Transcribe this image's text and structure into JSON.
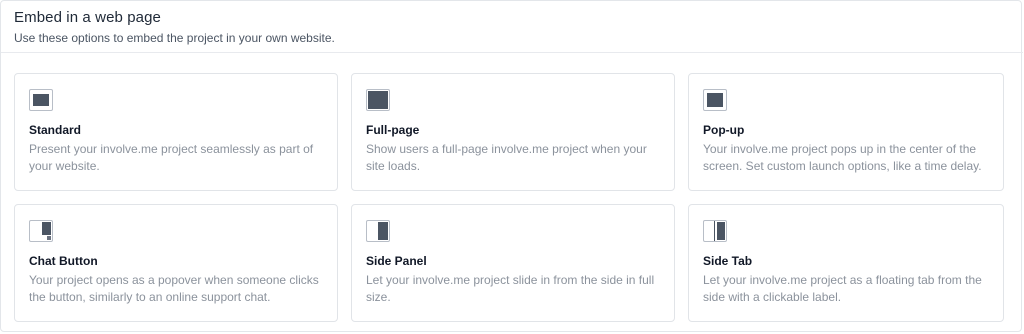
{
  "header": {
    "title": "Embed in a web page",
    "subtitle": "Use these options to embed the project in your own website."
  },
  "options": [
    {
      "title": "Standard",
      "description": "Present your involve.me project seamlessly as part of your website.",
      "icon": "standard-embed-icon"
    },
    {
      "title": "Full-page",
      "description": "Show users a full-page involve.me project when your site loads.",
      "icon": "full-page-icon"
    },
    {
      "title": "Pop-up",
      "description": "Your involve.me project pops up in the center of the screen. Set custom launch options, like a time delay.",
      "icon": "popup-icon"
    },
    {
      "title": "Chat Button",
      "description": "Your project opens as a popover when someone clicks the button, similarly to an online support chat.",
      "icon": "chat-button-icon"
    },
    {
      "title": "Side Panel",
      "description": "Let your involve.me project slide in from the side in full size.",
      "icon": "side-panel-icon"
    },
    {
      "title": "Side Tab",
      "description": "Let your involve.me project as a floating tab from the side with a clickable label.",
      "icon": "side-tab-icon"
    }
  ],
  "colors": {
    "icon_fill": "#4b5563",
    "border": "#e1e4e8",
    "description_text": "#8b929c"
  }
}
